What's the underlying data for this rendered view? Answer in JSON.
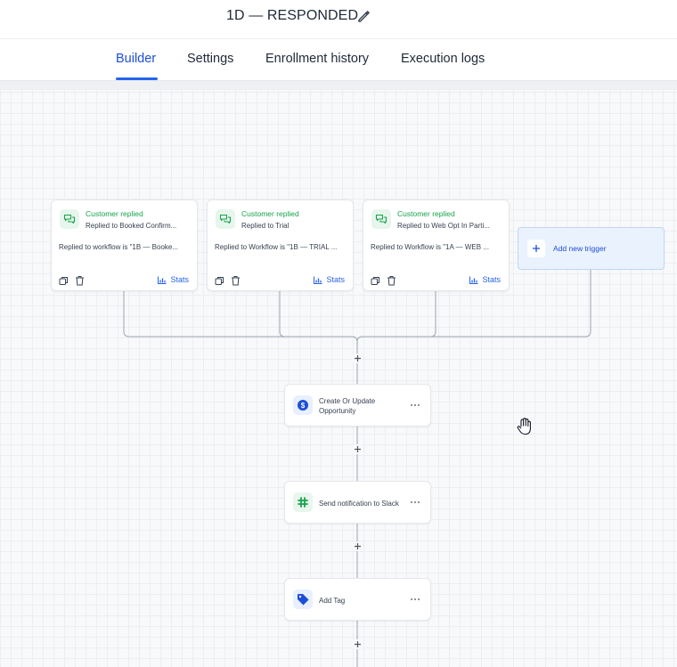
{
  "header": {
    "workflow_title": "1D — RESPONDED",
    "edit_icon": "pencil-icon"
  },
  "tabs": [
    {
      "label": "Builder",
      "active": true
    },
    {
      "label": "Settings",
      "active": false
    },
    {
      "label": "Enrollment history",
      "active": false
    },
    {
      "label": "Execution logs",
      "active": false
    }
  ],
  "triggers": [
    {
      "kind": "Customer replied",
      "name": "Replied to Booked Confirm...",
      "condition": "Replied to workflow is \"1B — Booke...",
      "stats_label": "Stats",
      "icon": "chat-bubbles-icon"
    },
    {
      "kind": "Customer replied",
      "name": "Replied to Trial",
      "condition": "Replied to Workflow is \"1B — TRIAL ...",
      "stats_label": "Stats",
      "icon": "chat-bubbles-icon"
    },
    {
      "kind": "Customer replied",
      "name": "Replied to Web Opt In Parti...",
      "condition": "Replied to Workflow is \"1A — WEB ...",
      "stats_label": "Stats",
      "icon": "chat-bubbles-icon"
    }
  ],
  "add_trigger": {
    "label": "Add new trigger",
    "icon": "plus-icon"
  },
  "actions": [
    {
      "label_line1": "Create Or Update",
      "label_line2": "Opportunity",
      "icon": "dollar-circle-icon",
      "icon_bg": "#e8efff",
      "icon_color": "#1d4ed8"
    },
    {
      "label_line1": "Send notification to Slack",
      "icon": "slack-icon",
      "icon_bg": "#e9f6ee",
      "icon_color": "#16a34a"
    },
    {
      "label_line1": "Add Tag",
      "icon": "tag-icon",
      "icon_bg": "#e8efff",
      "icon_color": "#1d4ed8"
    }
  ],
  "colors": {
    "accent": "#2563eb",
    "trigger_green": "#16a34a",
    "connector": "#9ca3af"
  }
}
